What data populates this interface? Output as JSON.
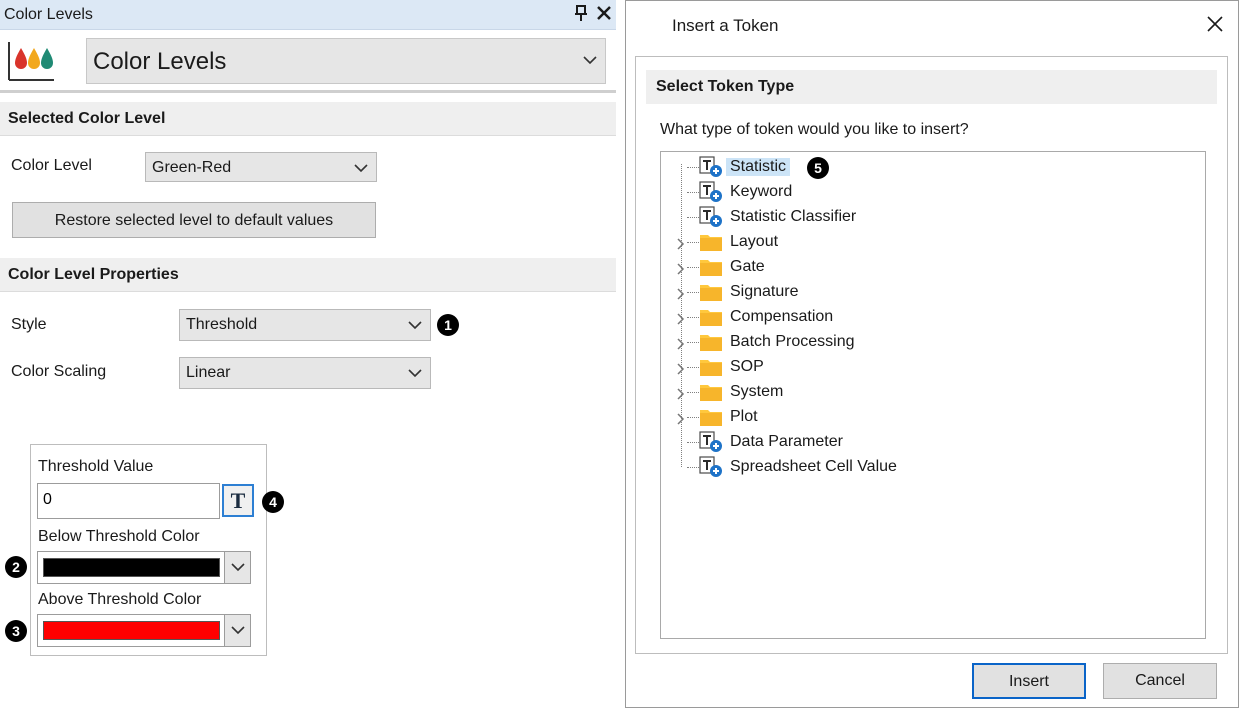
{
  "panel": {
    "title": "Color Levels",
    "header_dropdown": "Color Levels"
  },
  "selected_section": {
    "heading": "Selected Color Level",
    "color_level_label": "Color Level",
    "color_level_value": "Green-Red",
    "restore_button": "Restore selected level to default values"
  },
  "properties_section": {
    "heading": "Color Level Properties",
    "style_label": "Style",
    "style_value": "Threshold",
    "scaling_label": "Color Scaling",
    "scaling_value": "Linear"
  },
  "threshold": {
    "value_label": "Threshold Value",
    "value": "0",
    "token_button": "T",
    "below_label": "Below Threshold Color",
    "below_color": "#000000",
    "above_label": "Above Threshold Color",
    "above_color": "#ff0000"
  },
  "badges": [
    "1",
    "2",
    "3",
    "4",
    "5"
  ],
  "dialog": {
    "title": "Insert a Token",
    "section_heading": "Select Token Type",
    "question": "What type of token would you like to insert?",
    "insert_button": "Insert",
    "cancel_button": "Cancel",
    "tree_items": [
      {
        "label": "Statistic",
        "icon": "token-icon",
        "expandable": false,
        "selected": true
      },
      {
        "label": "Keyword",
        "icon": "token-icon",
        "expandable": false
      },
      {
        "label": "Statistic Classifier",
        "icon": "token-icon",
        "expandable": false
      },
      {
        "label": "Layout",
        "icon": "folder-icon",
        "expandable": true
      },
      {
        "label": "Gate",
        "icon": "folder-icon",
        "expandable": true
      },
      {
        "label": "Signature",
        "icon": "folder-icon",
        "expandable": true
      },
      {
        "label": "Compensation",
        "icon": "folder-icon",
        "expandable": true
      },
      {
        "label": "Batch Processing",
        "icon": "folder-icon",
        "expandable": true
      },
      {
        "label": "SOP",
        "icon": "folder-icon",
        "expandable": true
      },
      {
        "label": "System",
        "icon": "folder-icon",
        "expandable": true
      },
      {
        "label": "Plot",
        "icon": "folder-icon",
        "expandable": true
      },
      {
        "label": "Data Parameter",
        "icon": "token-icon",
        "expandable": false
      },
      {
        "label": "Spreadsheet Cell Value",
        "icon": "token-icon",
        "expandable": false
      }
    ]
  },
  "colors": {
    "titlebar_bg": "#dce8f5",
    "section_bg": "#efefef",
    "focus_blue": "#0a64c8",
    "folder_yellow": "#ffc83d"
  }
}
